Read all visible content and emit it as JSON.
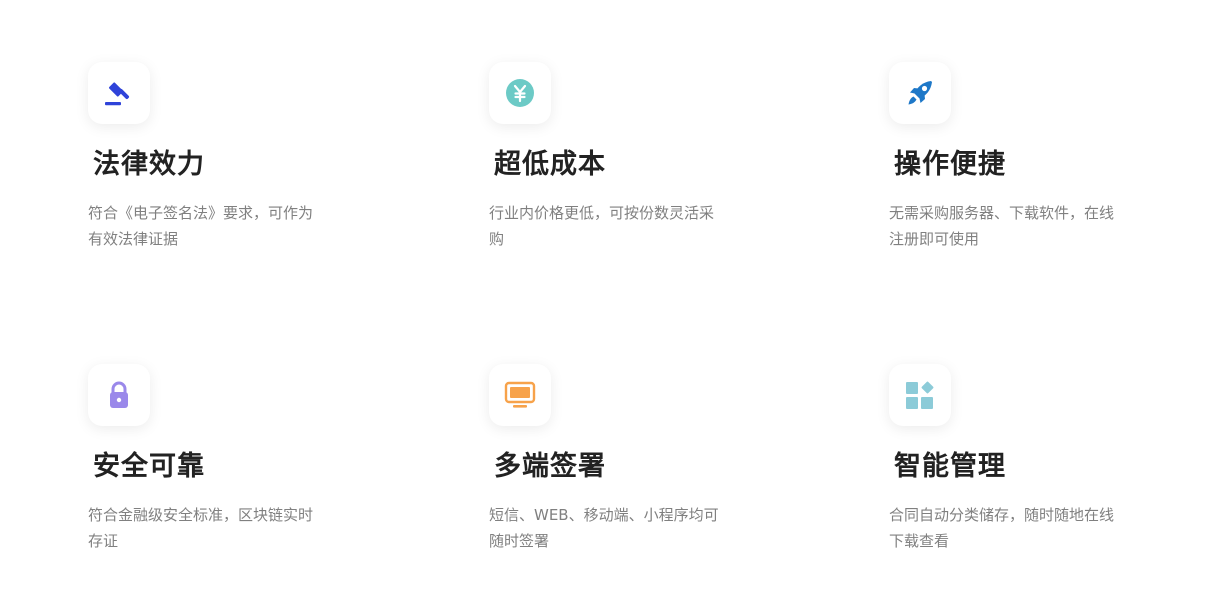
{
  "features": [
    {
      "title": "法律效力",
      "desc": "符合《电子签名法》要求，可作为有效法律证据",
      "icon": "gavel-icon",
      "color": "#2f43d9"
    },
    {
      "title": "超低成本",
      "desc": "行业内价格更低，可按份数灵活采购",
      "icon": "yen-coin-icon",
      "color": "#6ccac6"
    },
    {
      "title": "操作便捷",
      "desc": "无需采购服务器、下载软件，在线注册即可使用",
      "icon": "rocket-icon",
      "color": "#1e78c8"
    },
    {
      "title": "安全可靠",
      "desc": "符合金融级安全标准，区块链实时存证",
      "icon": "lock-icon",
      "color": "#9a88ea"
    },
    {
      "title": "多端签署",
      "desc": "短信、WEB、移动端、小程序均可随时签署",
      "icon": "monitor-icon",
      "color": "#f7a24a"
    },
    {
      "title": "智能管理",
      "desc": "合同自动分类储存，随时随地在线下载查看",
      "icon": "apps-grid-icon",
      "color": "#8ccbd8"
    }
  ]
}
